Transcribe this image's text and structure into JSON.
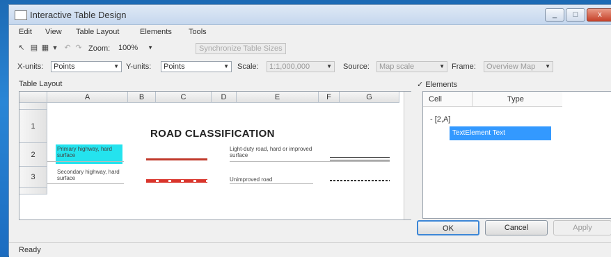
{
  "window": {
    "title": "Interactive Table Design",
    "controls": [
      "_",
      "□",
      "x"
    ]
  },
  "menu": [
    "Edit",
    "View",
    "Table Layout",
    "Elements",
    "Tools"
  ],
  "toolbar1": {
    "zoom_label": "Zoom:",
    "zoom_value": "100%",
    "sync_button": "Synchronize Table Sizes"
  },
  "toolbar2": {
    "xunits_label": "X-units:",
    "xunits_value": "Points",
    "yunits_label": "Y-units:",
    "yunits_value": "Points",
    "scale_label": "Scale:",
    "scale_value": "1:1,000,000",
    "source_label": "Source:",
    "source_value": "Map scale",
    "frame_label": "Frame:",
    "frame_value": "Overview Map"
  },
  "table_layout": {
    "label": "Table Layout",
    "columns": [
      "",
      "A",
      "B",
      "C",
      "D",
      "E",
      "F",
      "G"
    ],
    "rows": [
      "",
      "1",
      "2",
      "3",
      ""
    ],
    "heading": "ROAD CLASSIFICATION",
    "cells": {
      "a2": "Primary highway, hard surface",
      "a3": "Secondary highway, hard surface",
      "e2": "Light-duty road, hard or improved surface",
      "e3": "Unimproved road"
    },
    "road_colors": {
      "primary": "#c0392b",
      "secondary": "#d9342b",
      "light": "#333333",
      "unimproved": "#333333"
    },
    "highlight_color": "#24e3ee"
  },
  "elements": {
    "label": "Elements",
    "columns": [
      "Cell",
      "Type"
    ],
    "tree_root": "- [2,A]",
    "selected_item": "TextElement  Text"
  },
  "buttons": {
    "ok": "OK",
    "cancel": "Cancel",
    "apply": "Apply"
  },
  "status": "Ready"
}
